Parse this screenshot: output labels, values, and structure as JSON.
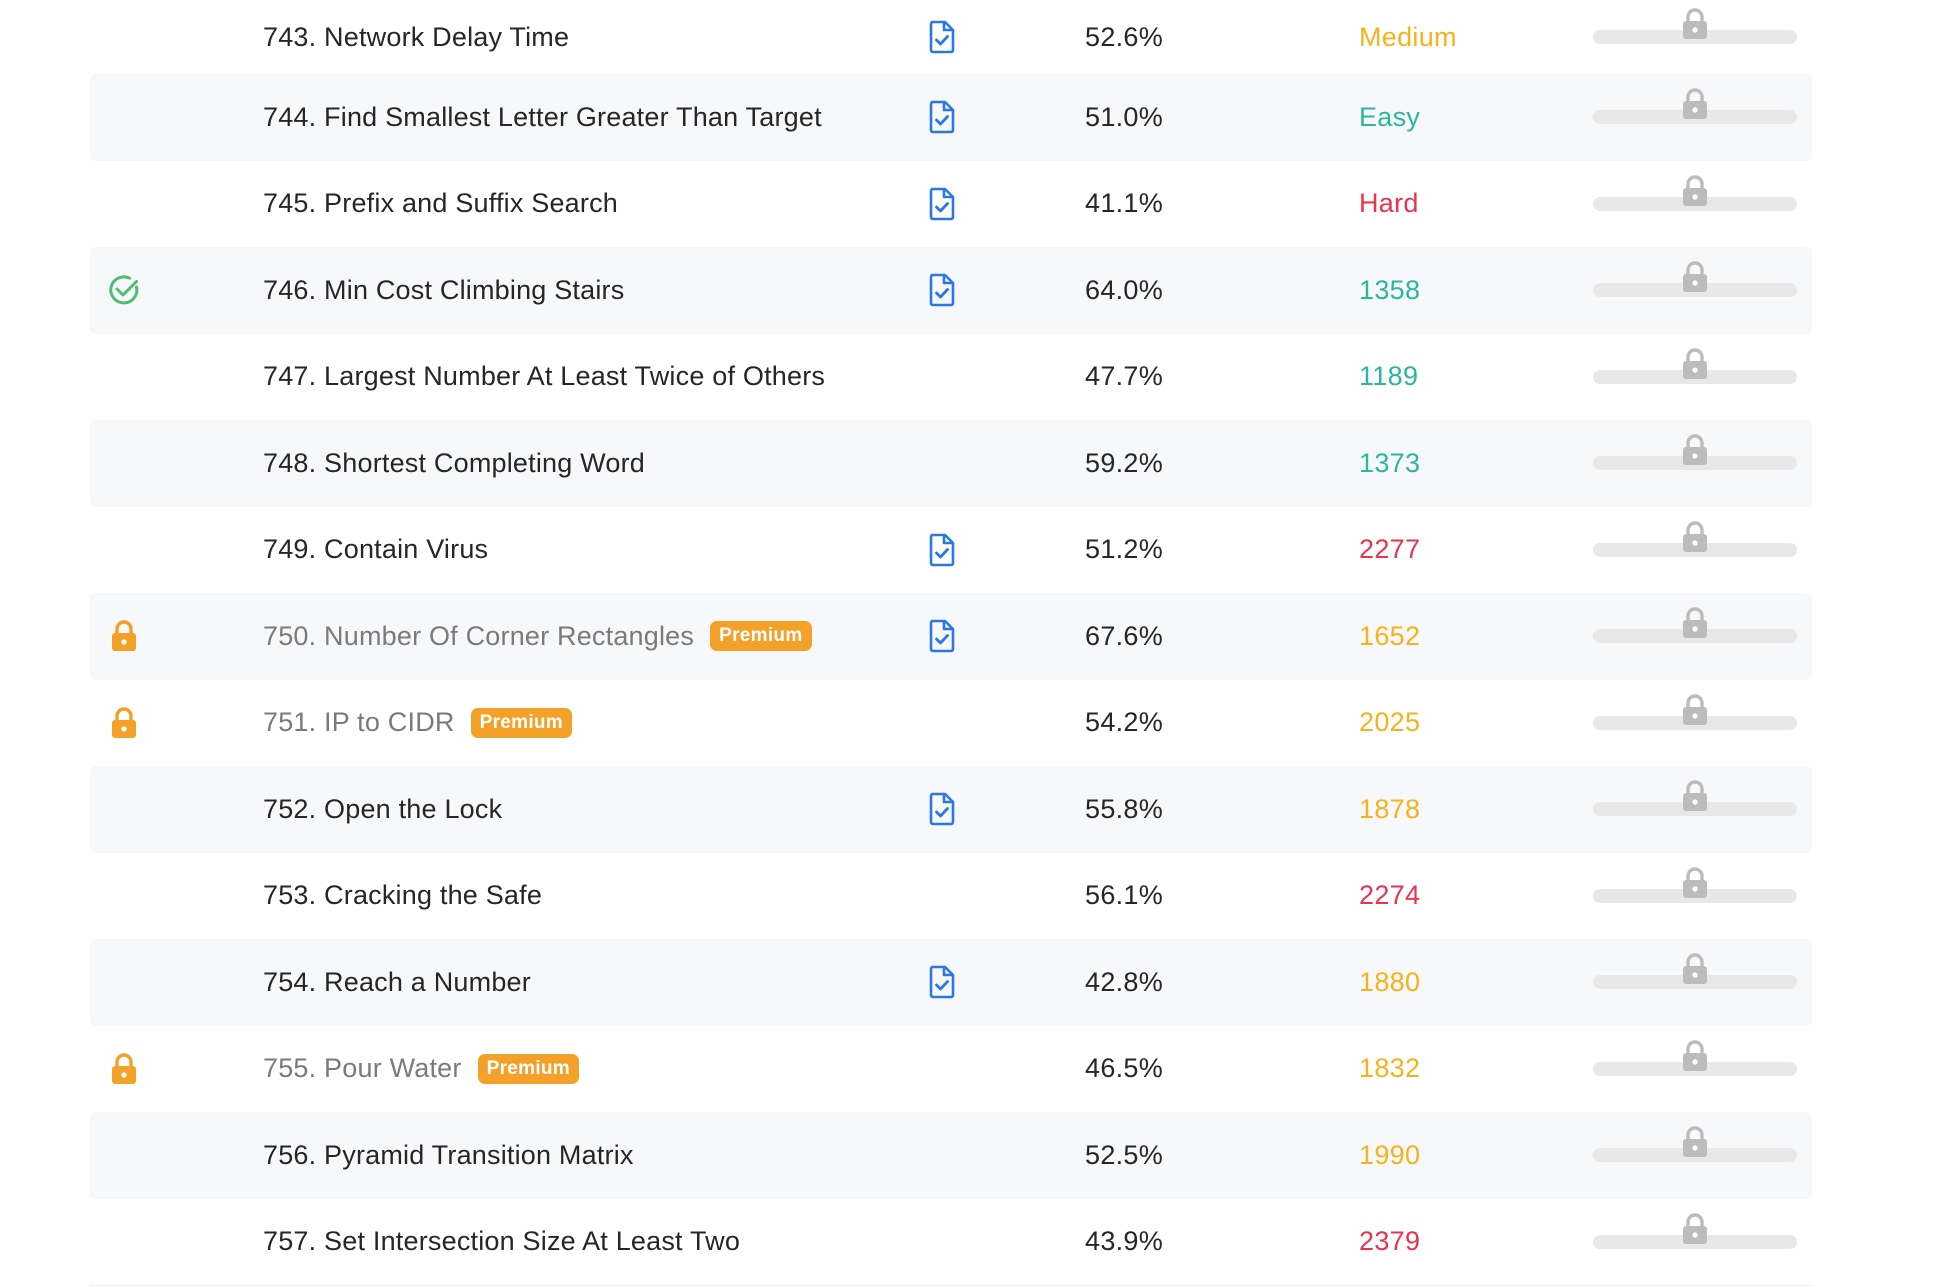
{
  "colors": {
    "easy": "#2cb5a0",
    "medium": "#f6b21b",
    "hard": "#e9334f",
    "premium_badge": "#f4a12a",
    "solution_icon": "#2a78e8",
    "solved_check": "#4cbf71",
    "lock": "#f4a12a",
    "freq_lock": "#bcbcbc"
  },
  "problems": [
    {
      "title": "743. Network Delay Time",
      "acceptance": "52.6%",
      "difficulty": "Medium",
      "difficulty_level": "medium",
      "has_solution": true,
      "status": "none",
      "premium": false
    },
    {
      "title": "744. Find Smallest Letter Greater Than Target",
      "acceptance": "51.0%",
      "difficulty": "Easy",
      "difficulty_level": "easy",
      "has_solution": true,
      "status": "none",
      "premium": false
    },
    {
      "title": "745. Prefix and Suffix Search",
      "acceptance": "41.1%",
      "difficulty": "Hard",
      "difficulty_level": "hard",
      "has_solution": true,
      "status": "none",
      "premium": false
    },
    {
      "title": "746. Min Cost Climbing Stairs",
      "acceptance": "64.0%",
      "difficulty": "1358",
      "difficulty_level": "easy",
      "has_solution": true,
      "status": "solved",
      "premium": false
    },
    {
      "title": "747. Largest Number At Least Twice of Others",
      "acceptance": "47.7%",
      "difficulty": "1189",
      "difficulty_level": "easy",
      "has_solution": false,
      "status": "none",
      "premium": false
    },
    {
      "title": "748. Shortest Completing Word",
      "acceptance": "59.2%",
      "difficulty": "1373",
      "difficulty_level": "easy",
      "has_solution": false,
      "status": "none",
      "premium": false
    },
    {
      "title": "749. Contain Virus",
      "acceptance": "51.2%",
      "difficulty": "2277",
      "difficulty_level": "hard",
      "has_solution": true,
      "status": "none",
      "premium": false
    },
    {
      "title": "750. Number Of Corner Rectangles",
      "acceptance": "67.6%",
      "difficulty": "1652",
      "difficulty_level": "medium",
      "has_solution": true,
      "status": "locked",
      "premium": true
    },
    {
      "title": "751. IP to CIDR",
      "acceptance": "54.2%",
      "difficulty": "2025",
      "difficulty_level": "medium",
      "has_solution": false,
      "status": "locked",
      "premium": true
    },
    {
      "title": "752. Open the Lock",
      "acceptance": "55.8%",
      "difficulty": "1878",
      "difficulty_level": "medium",
      "has_solution": true,
      "status": "none",
      "premium": false
    },
    {
      "title": "753. Cracking the Safe",
      "acceptance": "56.1%",
      "difficulty": "2274",
      "difficulty_level": "hard",
      "has_solution": false,
      "status": "none",
      "premium": false
    },
    {
      "title": "754. Reach a Number",
      "acceptance": "42.8%",
      "difficulty": "1880",
      "difficulty_level": "medium",
      "has_solution": true,
      "status": "none",
      "premium": false
    },
    {
      "title": "755. Pour Water",
      "acceptance": "46.5%",
      "difficulty": "1832",
      "difficulty_level": "medium",
      "has_solution": false,
      "status": "locked",
      "premium": true
    },
    {
      "title": "756. Pyramid Transition Matrix",
      "acceptance": "52.5%",
      "difficulty": "1990",
      "difficulty_level": "medium",
      "has_solution": false,
      "status": "none",
      "premium": false
    },
    {
      "title": "757. Set Intersection Size At Least Two",
      "acceptance": "43.9%",
      "difficulty": "2379",
      "difficulty_level": "hard",
      "has_solution": false,
      "status": "none",
      "premium": false
    }
  ],
  "premium_label": "Premium",
  "icons": {
    "solution": "solution-document-icon",
    "solved": "check-circle-icon",
    "locked": "lock-icon",
    "frequency_locked": "frequency-lock-icon"
  }
}
